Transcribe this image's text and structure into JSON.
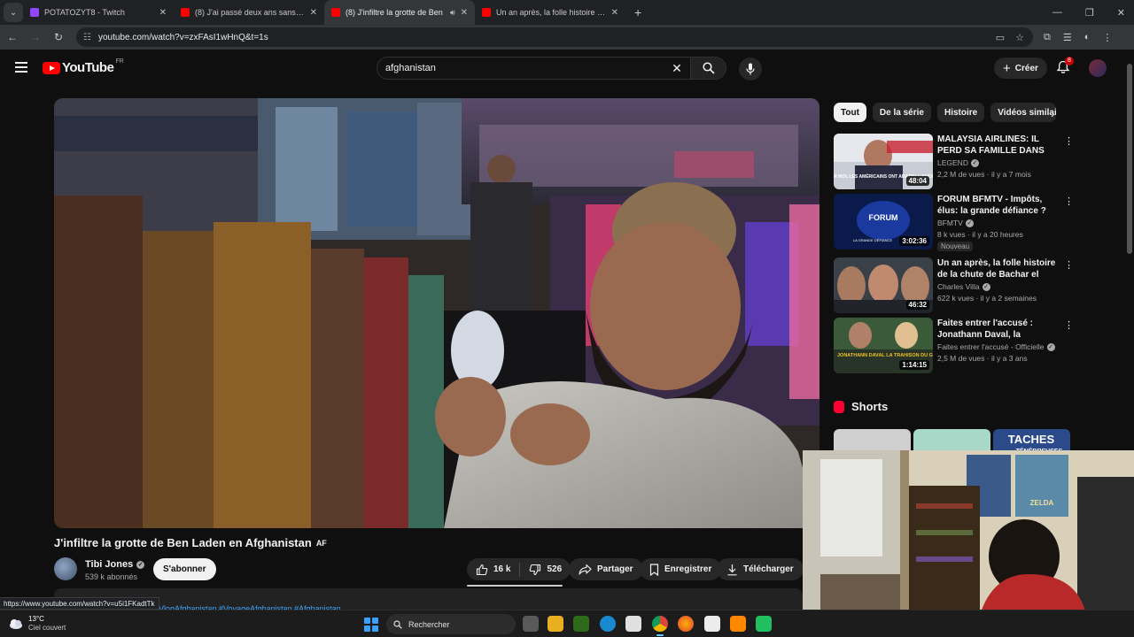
{
  "browser": {
    "tabs": [
      {
        "title": "POTATOZYT8 - Twitch",
        "favicon_color": "#9146ff",
        "active": false
      },
      {
        "title": "(8) J'ai passé deux ans sans pap",
        "favicon_color": "#ff0000",
        "active": false
      },
      {
        "title": "(8) J'infiltre la grotte de Ben",
        "favicon_color": "#ff0000",
        "active": true
      },
      {
        "title": "Un an après, la folle histoire de",
        "favicon_color": "#ff0000",
        "active": false
      }
    ],
    "url": "youtube.com/watch?v=zxFAsI1wHnQ&t=1s",
    "status_url": "https://www.youtube.com/watch?v=u5i1FKadtTk"
  },
  "masthead": {
    "logo_text": "YouTube",
    "country": "FR",
    "search_query": "afghanistan",
    "create_label": "Créer",
    "notification_count": "8"
  },
  "video": {
    "title": "J'infiltre la grotte de Ben Laden en Afghanistan",
    "title_badge": "AF",
    "channel": "Tibi Jones",
    "subscribers": "539 k abonnés",
    "subscribe_label": "S'abonner",
    "likes": "16 k",
    "dislikes": "526",
    "share_label": "Partager",
    "save_label": "Enregistrer",
    "download_label": "Télécharger",
    "hashtags": "VlogAfghanistan #VoyageAfghanistan #Afghanistan"
  },
  "chips": [
    "Tout",
    "De la série",
    "Histoire",
    "Vidéos similaires"
  ],
  "recommendations": [
    {
      "title": "MALAYSIA AIRLINES: IL PERD SA FAMILLE DANS LE PLUS ...",
      "channel": "LEGEND",
      "meta": "2,2 M de vues · il y a 7 mois",
      "duration": "48:04",
      "thumb_caption": "\"POUR MOI, LES AMÉRICAINS ONT ABATTU L'AVION\"",
      "new": ""
    },
    {
      "title": "FORUM BFMTV - Impôts, élus: la grande défiance ?",
      "channel": "BFMTV",
      "meta": "8 k vues · il y a 20 heures",
      "duration": "3:02:36",
      "thumb_caption": "FORUM",
      "thumb_caption_sub": "LA GRANDE DÉFIANCE",
      "new": "Nouveau"
    },
    {
      "title": "Un an après, la folle histoire de la chute de Bachar el Assad",
      "channel": "Charles Villa",
      "meta": "622 k vues · il y a 2 semaines",
      "duration": "46:32",
      "thumb_caption": "",
      "new": ""
    },
    {
      "title": "Faites entrer l'accusé : Jonathann Daval, la trahison d...",
      "channel": "Faites entrer l'accusé - Officielle",
      "meta": "2,5 M de vues · il y a 3 ans",
      "duration": "1:14:15",
      "thumb_caption": "JONATHANN DAVAL LA TRAHISON DU GENDRE IDÉAL",
      "new": ""
    }
  ],
  "shorts": {
    "heading": "Shorts",
    "third_thumb_text": "TACHES",
    "third_thumb_sub": "TÉNÉBREUSES"
  },
  "webcam_poster": "ZELDA",
  "taskbar": {
    "temperature": "13°C",
    "condition": "Ciel couvert",
    "search_label": "Rechercher"
  },
  "colors": {
    "yt_red": "#ff0000",
    "link_blue": "#3ea6ff",
    "background": "#0f0f0f",
    "pill_bg": "#272727"
  }
}
